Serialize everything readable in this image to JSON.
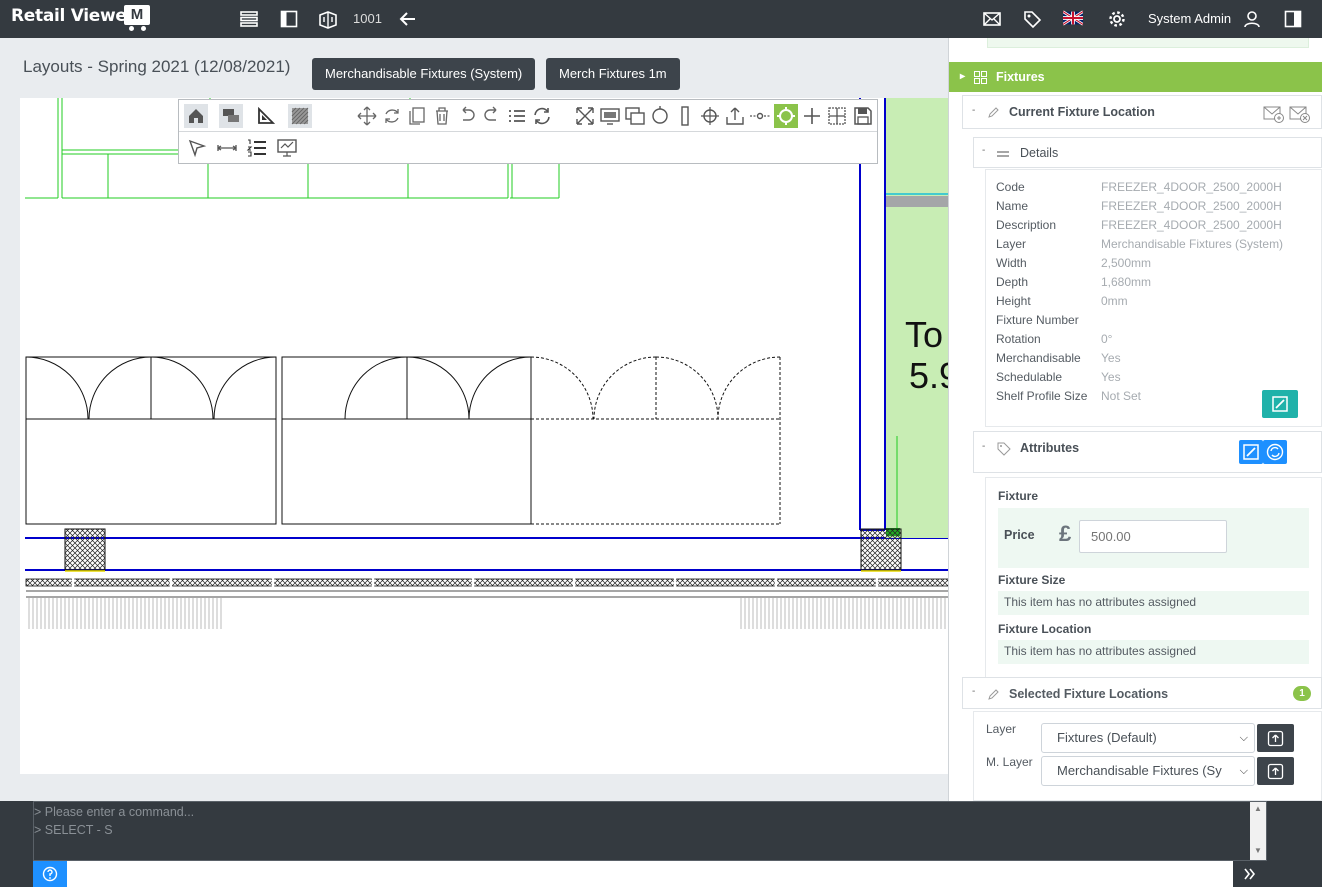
{
  "app": {
    "logo_text": "Retail Viewer",
    "logo_mark": "M",
    "store_number": "1001"
  },
  "header": {
    "user_name": "System Admin"
  },
  "layout": {
    "title": "Layouts - Spring 2021 (12/08/2021)"
  },
  "layer_buttons": [
    "Merchandisable Fixtures (System)",
    "Merch Fixtures 1m"
  ],
  "canvas": {
    "fixture_label_line1": "To",
    "fixture_label_line2": "5.9"
  },
  "panel": {
    "fixtures_label": "Fixtures",
    "current_fixture_location_label": "Current Fixture Location",
    "details_label": "Details",
    "details": [
      {
        "label": "Code",
        "value": "FREEZER_4DOOR_2500_2000H"
      },
      {
        "label": "Name",
        "value": "FREEZER_4DOOR_2500_2000H"
      },
      {
        "label": "Description",
        "value": "FREEZER_4DOOR_2500_2000H"
      },
      {
        "label": "Layer",
        "value": "Merchandisable Fixtures (System)"
      },
      {
        "label": "Width",
        "value": "2,500mm"
      },
      {
        "label": "Depth",
        "value": "1,680mm"
      },
      {
        "label": "Height",
        "value": "0mm"
      },
      {
        "label": "Fixture Number",
        "value": ""
      },
      {
        "label": "Rotation",
        "value": "0°"
      },
      {
        "label": "Merchandisable",
        "value": "Yes"
      },
      {
        "label": "Schedulable",
        "value": "Yes"
      },
      {
        "label": "Shelf Profile Size",
        "value": "Not Set"
      }
    ],
    "attributes_label": "Attributes",
    "fixture_label": "Fixture",
    "price_label": "Price",
    "currency_symbol": "£",
    "price_placeholder": "500.00",
    "fixture_size_label": "Fixture Size",
    "fixture_size_empty": "This item has no attributes assigned",
    "fixture_location_label": "Fixture Location",
    "fixture_location_empty": "This item has no attributes assigned",
    "selected_locations_label": "Selected Fixture Locations",
    "selected_locations_count": "1",
    "layer_field_label": "Layer",
    "layer_value": "Fixtures (Default)",
    "mlayer_field_label": "M. Layer",
    "mlayer_value": "Merchandisable Fixtures (Sy"
  },
  "console": {
    "line1": "> Please enter a command...",
    "line2": "> SELECT - S",
    "input_value": ""
  },
  "colors": {
    "topbar": "#343a40",
    "accent_green": "#8bc34a",
    "teal": "#20b2aa",
    "blue": "#1e90ff",
    "fixture_fill": "#c8edb4",
    "wall_blue": "#0000cc"
  }
}
